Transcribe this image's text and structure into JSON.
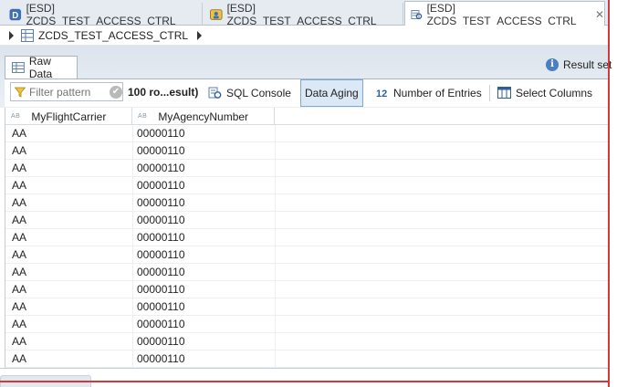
{
  "tabs": [
    {
      "label": "[ESD] ZCDS_TEST_ACCESS_CTRL",
      "icon": "ddl-source-icon",
      "active": false
    },
    {
      "label": "[ESD] ZCDS_TEST_ACCESS_CTRL",
      "icon": "access-control-icon",
      "active": false
    },
    {
      "label": "[ESD] ZCDS_TEST_ACCESS_CTRL",
      "icon": "data-preview-icon",
      "active": true,
      "close": "✕"
    }
  ],
  "breadcrumb": {
    "label": "ZCDS_TEST_ACCESS_CTRL"
  },
  "raw_data_tab": {
    "label": "Raw Data"
  },
  "result_set": {
    "label": "Result set"
  },
  "toolbar": {
    "filter_placeholder": "Filter pattern",
    "rows_label": "100 ro...esult)",
    "sql_console": "SQL Console",
    "data_aging": "Data Aging",
    "number_of_entries": "Number of Entries",
    "select_columns": "Select Columns"
  },
  "grid": {
    "columns": [
      {
        "type": "AB",
        "label": "MyFlightCarrier"
      },
      {
        "type": "AB",
        "label": "MyAgencyNumber"
      }
    ],
    "rows": [
      [
        "AA",
        "00000110"
      ],
      [
        "AA",
        "00000110"
      ],
      [
        "AA",
        "00000110"
      ],
      [
        "AA",
        "00000110"
      ],
      [
        "AA",
        "00000110"
      ],
      [
        "AA",
        "00000110"
      ],
      [
        "AA",
        "00000110"
      ],
      [
        "AA",
        "00000110"
      ],
      [
        "AA",
        "00000110"
      ],
      [
        "AA",
        "00000110"
      ],
      [
        "AA",
        "00000110"
      ],
      [
        "AA",
        "00000110"
      ],
      [
        "AA",
        "00000110"
      ],
      [
        "AA",
        "00000110"
      ]
    ]
  },
  "colors": {
    "accent_blue": "#4a7fc1",
    "pressed_bg": "#dbe8f6",
    "frame_red": "#d23a3a"
  }
}
